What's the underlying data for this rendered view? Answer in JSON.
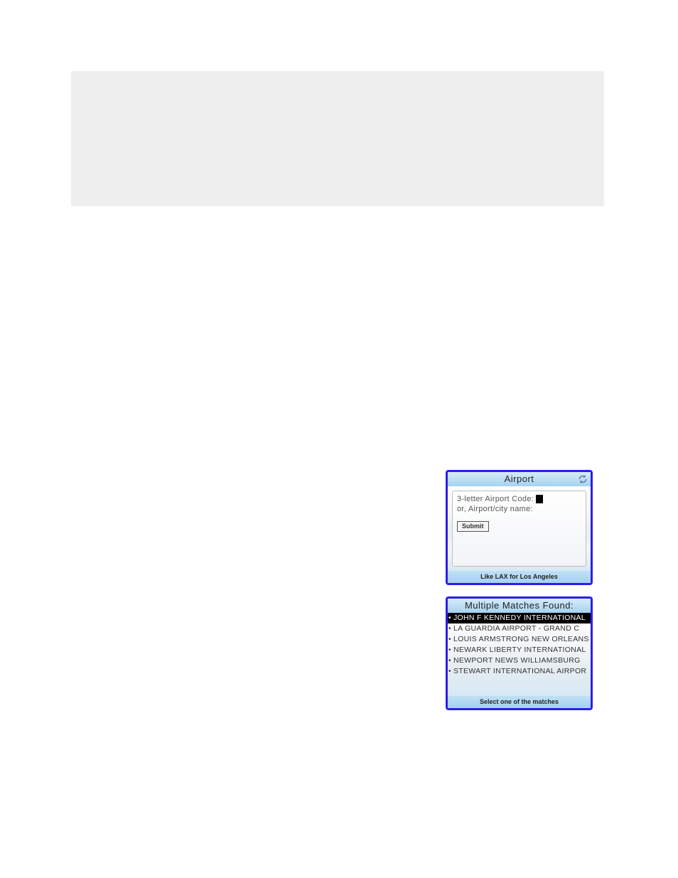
{
  "airport_widget": {
    "title": "Airport",
    "label_line1": "3-letter Airport Code:",
    "label_line2": "or, Airport/city name:",
    "submit_label": "Submit",
    "hint": "Like LAX for Los Angeles"
  },
  "matches_widget": {
    "title": "Multiple Matches Found:",
    "items": [
      "JOHN F KENNEDY INTERNATIONAL",
      "LA GUARDIA AIRPORT - GRAND C",
      "LOUIS ARMSTRONG NEW ORLEANS",
      "NEWARK LIBERTY INTERNATIONAL",
      "NEWPORT NEWS WILLIAMSBURG",
      "STEWART INTERNATIONAL AIRPOR"
    ],
    "selected_index": 0,
    "hint": "Select one of the matches"
  }
}
